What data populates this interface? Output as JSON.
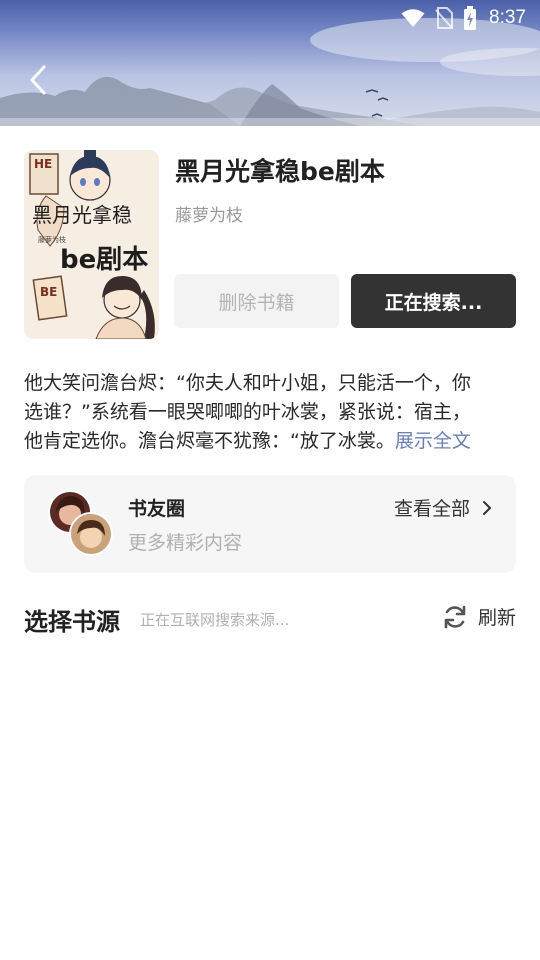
{
  "status_bar": {
    "time": "8:37"
  },
  "book": {
    "title": "黑月光拿稳be剧本",
    "author": "藤萝为枝",
    "cover_badge_he": "HE",
    "cover_badge_be": "BE",
    "cover_title_line1": "黑月光拿稳",
    "cover_title_line2": "be剧本",
    "cover_author": "藤萝为枝"
  },
  "actions": {
    "delete_label": "删除书籍",
    "searching_label": "正在搜索..."
  },
  "summary": {
    "line1": "他大笑问澹台烬：“你夫人和叶小姐，只能活一个，你",
    "line2": "选谁？”系统看一眼哭唧唧的叶冰裳，紧张说：宿主，",
    "line3": "他肯定选你。澹台烬毫不犹豫：“放了冰裳。",
    "expand_label": "展示全文"
  },
  "circle": {
    "title": "书友圈",
    "subtitle": "更多精彩内容",
    "view_all": "查看全部"
  },
  "source": {
    "title": "选择书源",
    "hint": "正在互联网搜索来源...",
    "refresh_label": "刷新"
  },
  "colors": {
    "accent_dark": "#333333",
    "link": "#6a7fb8",
    "muted": "#b0b0b0"
  },
  "icons": [
    "wifi-icon",
    "no-sim-icon",
    "battery-charging-icon",
    "back-arrow-icon",
    "chevron-right-icon",
    "refresh-icon"
  ]
}
